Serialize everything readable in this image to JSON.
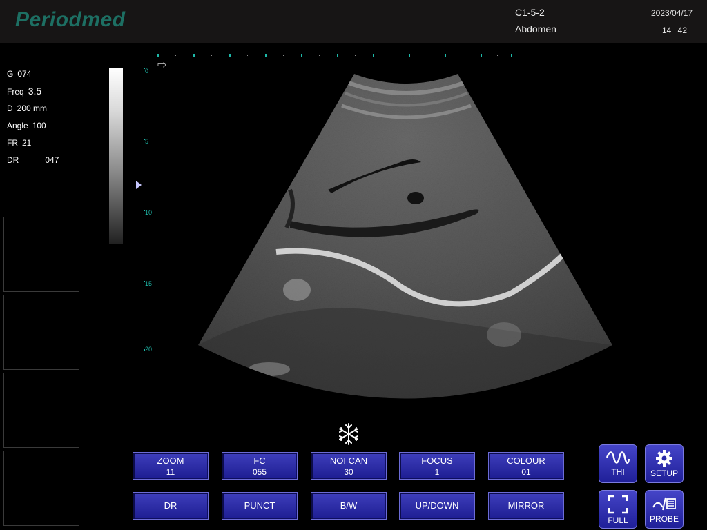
{
  "header": {
    "logo": "Periodmed",
    "probe": "C1-5-2",
    "exam": "Abdomen",
    "date": "2023/04/17",
    "time": "14 42"
  },
  "params": [
    {
      "label": "G",
      "value": "074"
    },
    {
      "label": "Freq",
      "value": "3.5"
    },
    {
      "label": "D",
      "value": "200 mm"
    },
    {
      "label": "Angle",
      "value": "100"
    },
    {
      "label": "FR",
      "value": "21"
    },
    {
      "label": "DR",
      "value": "047"
    }
  ],
  "depth_scale": [
    "0",
    "5",
    "10",
    "15",
    "20"
  ],
  "toolbar_row1": [
    {
      "label": "ZOOM",
      "value": "11"
    },
    {
      "label": "FC",
      "value": "055"
    },
    {
      "label": "NOI CAN",
      "value": "30"
    },
    {
      "label": "FOCUS",
      "value": "1"
    },
    {
      "label": "COLOUR",
      "value": "01"
    }
  ],
  "toolbar_row2": [
    "DR",
    "PUNCT",
    "B/W",
    "UP/DOWN",
    "MIRROR"
  ],
  "icon_buttons": {
    "thi": "THI",
    "setup": "SETUP",
    "full": "FULL",
    "probe": "PROBE"
  },
  "icons": [
    "freeze-snowflake-icon",
    "thi-wave-icon",
    "gear-icon",
    "fullscreen-icon",
    "probe-icon"
  ],
  "colors": {
    "header_bg": "#171515",
    "logo": "#1d6f63",
    "button_blue": "#2a2aa8",
    "scale_teal": "#1db8a8"
  }
}
